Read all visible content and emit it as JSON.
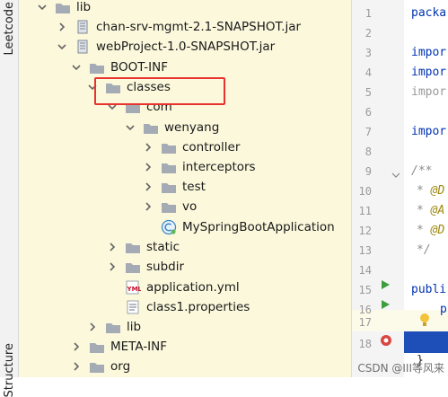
{
  "side_labels": {
    "top": "Leetcode",
    "bottom": "Structure"
  },
  "tree": {
    "rows": [
      {
        "label": "lib",
        "icon": "folder-icon",
        "arrow": "expanded"
      },
      {
        "label": "chan-srv-mgmt-2.1-SNAPSHOT.jar",
        "icon": "jar-icon",
        "arrow": "collapsed"
      },
      {
        "label": "webProject-1.0-SNAPSHOT.jar",
        "icon": "jar-icon",
        "arrow": "expanded"
      },
      {
        "label": "BOOT-INF",
        "icon": "folder-icon",
        "arrow": "expanded"
      },
      {
        "label": "classes",
        "icon": "folder-icon",
        "arrow": "expanded"
      },
      {
        "label": "com",
        "icon": "folder-icon",
        "arrow": "expanded"
      },
      {
        "label": "wenyang",
        "icon": "folder-icon",
        "arrow": "expanded"
      },
      {
        "label": "controller",
        "icon": "folder-icon",
        "arrow": "collapsed"
      },
      {
        "label": "interceptors",
        "icon": "folder-icon",
        "arrow": "collapsed"
      },
      {
        "label": "test",
        "icon": "folder-icon",
        "arrow": "collapsed"
      },
      {
        "label": "vo",
        "icon": "folder-icon",
        "arrow": "collapsed"
      },
      {
        "label": "MySpringBootApplication",
        "icon": "spring-class-icon",
        "arrow": "none"
      },
      {
        "label": "static",
        "icon": "folder-icon",
        "arrow": "collapsed"
      },
      {
        "label": "subdir",
        "icon": "folder-icon",
        "arrow": "collapsed"
      },
      {
        "label": "application.yml",
        "icon": "yml-file-icon",
        "arrow": "none"
      },
      {
        "label": "class1.properties",
        "icon": "properties-file-icon",
        "arrow": "none"
      },
      {
        "label": "lib",
        "icon": "folder-icon",
        "arrow": "collapsed"
      },
      {
        "label": "META-INF",
        "icon": "folder-icon",
        "arrow": "collapsed"
      },
      {
        "label": "org",
        "icon": "folder-icon",
        "arrow": "collapsed"
      }
    ]
  },
  "editor": {
    "line_numbers": [
      "1",
      "2",
      "3",
      "4",
      "5",
      "6",
      "7",
      "8",
      "9",
      "10",
      "11",
      "12",
      "13",
      "14",
      "15",
      "16",
      "17",
      "18"
    ],
    "lines": {
      "l1": "packa",
      "l3": "impor",
      "l4": "impor",
      "l5": "impor",
      "l7": "impor",
      "l9": "/**",
      "l10_star": "* ",
      "l10_ann": "@D",
      "l11_star": "* ",
      "l11_ann": "@A",
      "l12_star": "* ",
      "l12_ann": "@D",
      "l13": "*/",
      "l15": "publi",
      "l16": "p",
      "l19": "}"
    }
  },
  "watermark": "CSDN @III等风来",
  "colors": {
    "highlight": "#e8322d",
    "tree_bg": "#fbf8dc",
    "folder": "#a5abb4",
    "run_green": "#3e9e3e",
    "selection": "#1e4fb8"
  }
}
